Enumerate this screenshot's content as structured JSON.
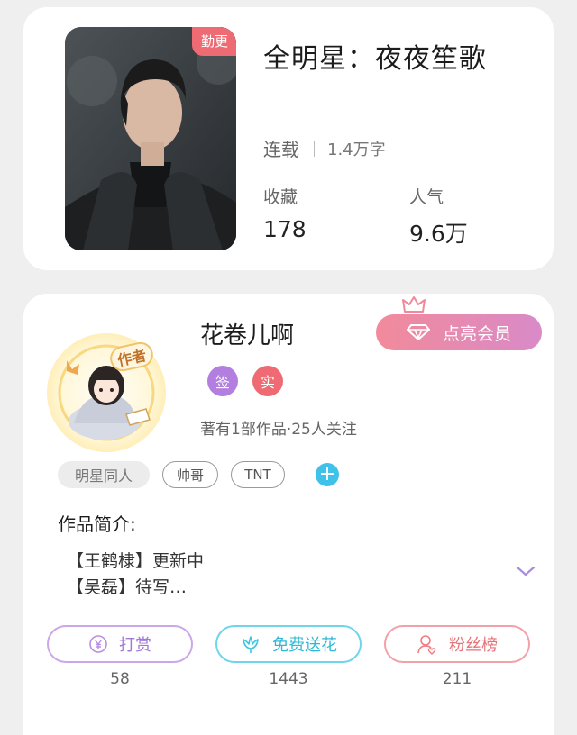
{
  "book": {
    "title": "全明星：夜夜笙歌",
    "badge": "勤更",
    "status": "连载",
    "word_count": "1.4万字",
    "stats": [
      {
        "label": "收藏",
        "value": "178"
      },
      {
        "label": "人气",
        "value": "9.6万"
      }
    ]
  },
  "author": {
    "name": "花卷儿啊",
    "avatar_tag": "作者",
    "vip_button": "点亮会员",
    "badges": [
      {
        "label": "签",
        "color": "#b27ee0"
      },
      {
        "label": "实",
        "color": "#ee6b73"
      }
    ],
    "works_line": "著有1部作品·25人关注"
  },
  "tags": [
    "明星同人",
    "帅哥",
    "TNT"
  ],
  "intro": {
    "heading": "作品简介:",
    "lines": [
      "【王鹤棣】更新中",
      "【吴磊】待写…"
    ]
  },
  "actions": [
    {
      "label": "打赏",
      "count": "58",
      "color": "#b98fe3",
      "icon": "yen-icon"
    },
    {
      "label": "免费送花",
      "count": "1443",
      "color": "#3cc6e0",
      "icon": "flower-icon"
    },
    {
      "label": "粉丝榜",
      "count": "211",
      "color": "#ef7d84",
      "icon": "fan-user-icon"
    }
  ],
  "colors": {
    "page_bg": "#efefef",
    "badge": "#ee6b73",
    "plus": "#3fc1ea",
    "chevron": "#a98be0"
  }
}
